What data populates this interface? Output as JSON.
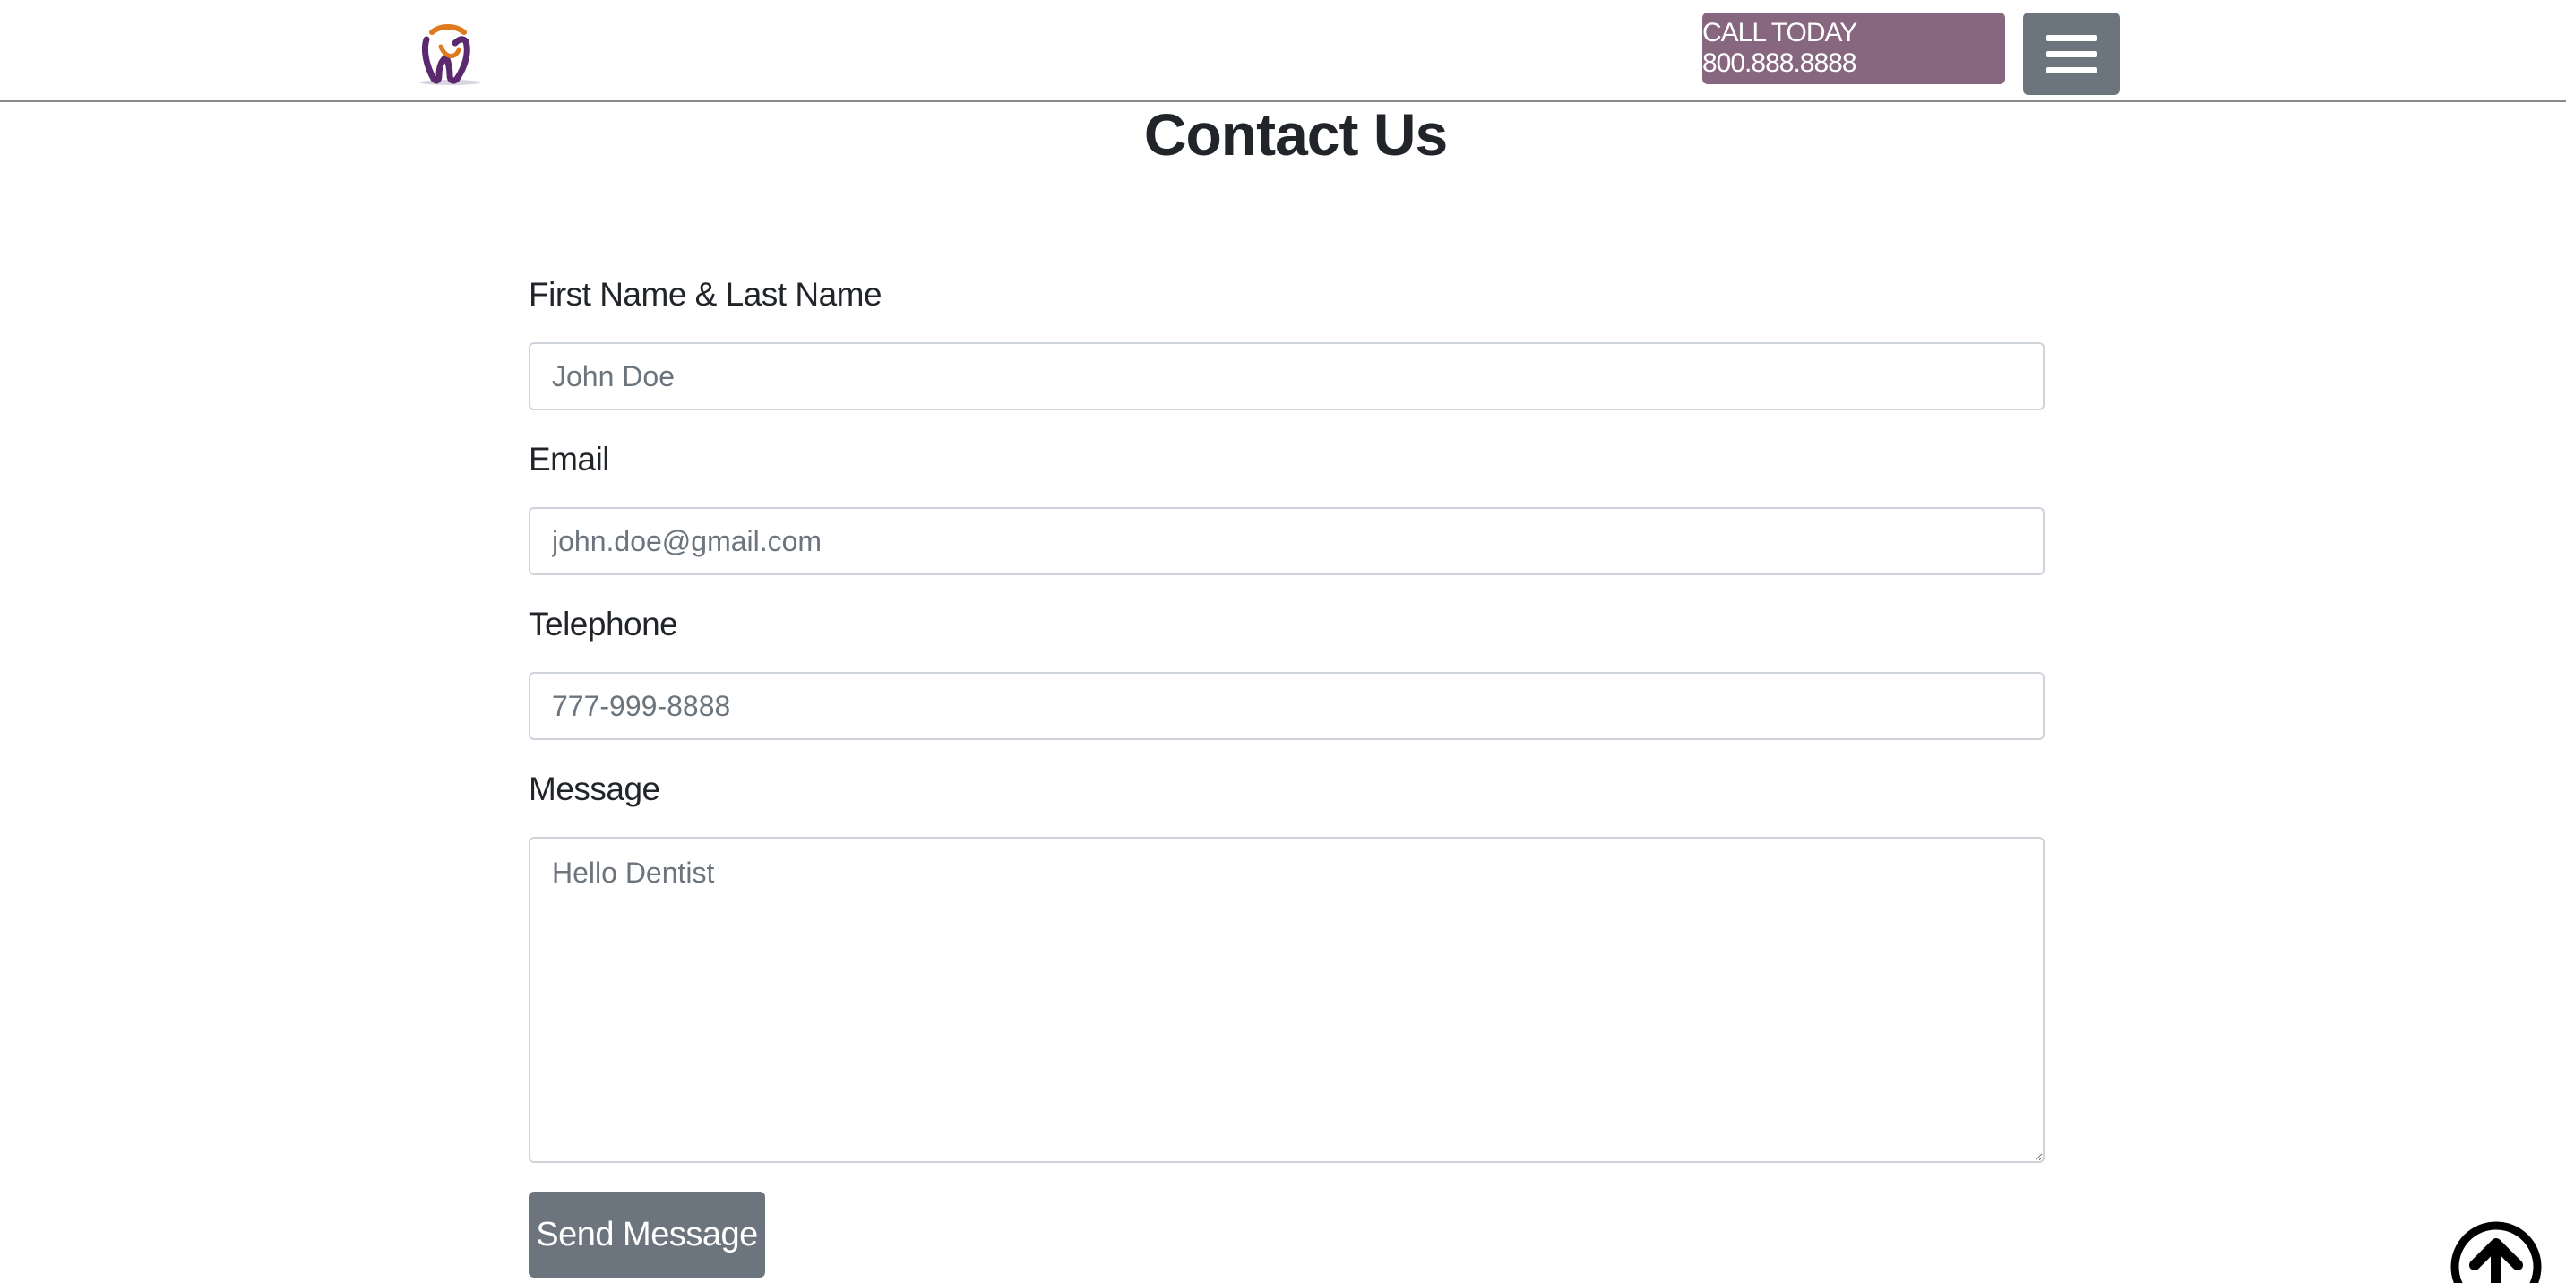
{
  "header": {
    "logo_name": "tooth-logo",
    "call_label": "CALL TODAY 800.888.8888",
    "menu_icon": "hamburger-menu-icon"
  },
  "page_title": "Contact Us",
  "form": {
    "name_label": "First Name & Last Name",
    "name_placeholder": "John Doe",
    "email_label": "Email",
    "email_placeholder": "john.doe@gmail.com",
    "phone_label": "Telephone",
    "phone_placeholder": "777-999-8888",
    "message_label": "Message",
    "message_placeholder": "Hello Dentist",
    "submit_label": "Send Message"
  },
  "scroll_top_icon": "arrow-up-circle-icon",
  "colors": {
    "accent": "#86677f",
    "button_gray": "#6c757d",
    "logo_purple": "#5b2a6e",
    "logo_orange": "#e07a1f"
  }
}
